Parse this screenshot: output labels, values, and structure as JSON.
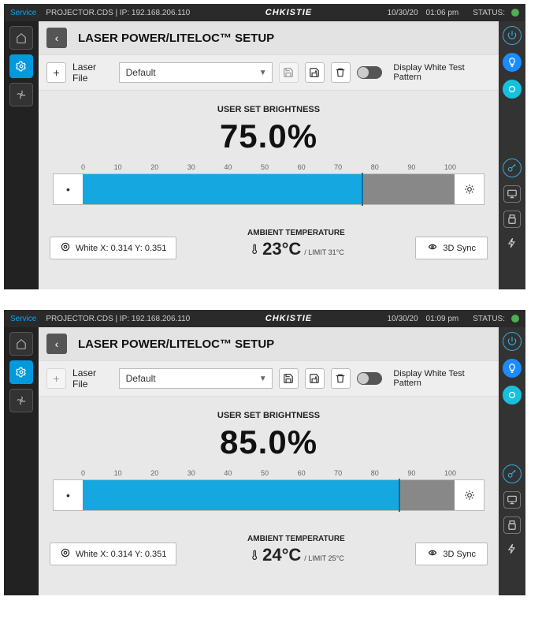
{
  "screens": [
    {
      "topbar": {
        "service": "Service",
        "proj": "PROJECTOR.CDS  |  IP: 192.168.206.110",
        "brand": "CHKISTIE",
        "date": "10/30/20",
        "time": "01:06 pm",
        "status_label": "STATUS:"
      },
      "title": "LASER POWER/LITELOC™ SETUP",
      "toolbar": {
        "laser_file_label": "Laser File",
        "laser_file_value": "Default",
        "toggle_label": "Display White Test Pattern",
        "add_disabled": false,
        "save_disabled": true
      },
      "brightness": {
        "label": "USER SET BRIGHTNESS",
        "value_pct": "75.0%",
        "fill_pct": 75,
        "ticks": [
          "0",
          "10",
          "20",
          "30",
          "40",
          "50",
          "60",
          "70",
          "80",
          "90",
          "100"
        ]
      },
      "bottom": {
        "white_label": "White  X: 0.314  Y: 0.351",
        "temp_label": "AMBIENT TEMPERATURE",
        "temp_value": "23°C",
        "temp_limit": "/ LIMIT 31°C",
        "sync_label": "3D Sync"
      }
    },
    {
      "topbar": {
        "service": "Service",
        "proj": "PROJECTOR.CDS  |  IP: 192.168.206.110",
        "brand": "CHKISTIE",
        "date": "10/30/20",
        "time": "01:09 pm",
        "status_label": "STATUS:"
      },
      "title": "LASER POWER/LITELOC™ SETUP",
      "toolbar": {
        "laser_file_label": "Laser File",
        "laser_file_value": "Default",
        "toggle_label": "Display White Test Pattern",
        "add_disabled": true,
        "save_disabled": false
      },
      "brightness": {
        "label": "USER SET BRIGHTNESS",
        "value_pct": "85.0%",
        "fill_pct": 85,
        "ticks": [
          "0",
          "10",
          "20",
          "30",
          "40",
          "50",
          "60",
          "70",
          "80",
          "90",
          "100"
        ]
      },
      "bottom": {
        "white_label": "White  X: 0.314  Y: 0.351",
        "temp_label": "AMBIENT TEMPERATURE",
        "temp_value": "24°C",
        "temp_limit": "/ LIMIT 25°C",
        "sync_label": "3D Sync"
      }
    }
  ]
}
